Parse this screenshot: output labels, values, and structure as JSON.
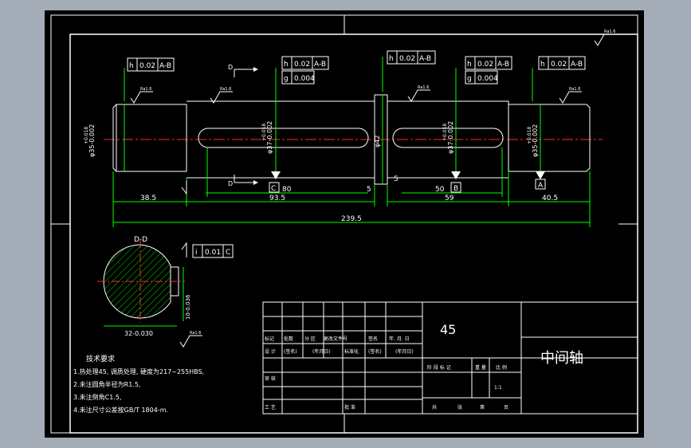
{
  "drawing": {
    "shaft_name": "中间轴",
    "material": "45",
    "scale": "1:1"
  },
  "dimensions": {
    "total_length": "239.5",
    "seg_left": "38.5",
    "seg_mid": "93.5",
    "seg_right_key": "59",
    "seg_right_end": "40.5",
    "collar_w1": "5",
    "collar_w2": "5",
    "key_left_len": "80",
    "key_right_len": "50",
    "diam_left": "φ35-0.002",
    "diam_left_tol": "+0.018",
    "diam_mid": "φ37-0.002",
    "diam_mid_tol": "+0.018",
    "diam_collar": "φ42",
    "diam_right_key": "φ37-0.002",
    "diam_right_key_tol": "+0.018",
    "diam_right": "φ35-0.002",
    "diam_right_tol": "+0.018",
    "section_width": "32-0.030",
    "section_depth": "10-0.036"
  },
  "tolerances": {
    "frame1": {
      "sym": "h",
      "val": "0.02",
      "ref": "A-B"
    },
    "frame2a": {
      "sym": "h",
      "val": "0.02",
      "ref": "A-B"
    },
    "frame2b": {
      "sym": "g",
      "val": "0.004",
      "ref": ""
    },
    "frame3": {
      "sym": "h",
      "val": "0.02",
      "ref": "A-B"
    },
    "frame4a": {
      "sym": "h",
      "val": "0.02",
      "ref": "A-B"
    },
    "frame4b": {
      "sym": "g",
      "val": "0.004",
      "ref": ""
    },
    "frame5": {
      "sym": "h",
      "val": "0.02",
      "ref": "A-B"
    },
    "section_frame": {
      "sym": "i",
      "val": "0.01",
      "ref": "C"
    }
  },
  "datums": {
    "a": "A",
    "b": "B",
    "c": "C"
  },
  "views": {
    "section_label": "D-D",
    "cut_label_top": "D",
    "cut_label_bottom": "D"
  },
  "roughness": {
    "mark": "Ra1.6"
  },
  "notes": {
    "title": "技术要求",
    "items": [
      "1.热处理45, 调质处理, 硬度为217~255HBS,",
      "2.未注圆角半径为R1.5,",
      "3.未注倒角C1.5,",
      "4.未注尺寸公差按GB/T 1804-m."
    ]
  },
  "title_block": {
    "row1": [
      "标记",
      "处数",
      "分 区",
      "更改文件号",
      "签名",
      "年. 月. 日"
    ],
    "row2": [
      "设 计",
      "(签名)",
      "(年月日)",
      "标准化",
      "(签名)",
      "(年月日)"
    ],
    "row3": [
      "审 核"
    ],
    "row4": [
      "工 艺",
      "批 准"
    ],
    "stage": [
      "阶 段 标 记",
      "重 量",
      "比 例"
    ],
    "sheet": [
      "共",
      "张",
      "第",
      "页"
    ]
  }
}
